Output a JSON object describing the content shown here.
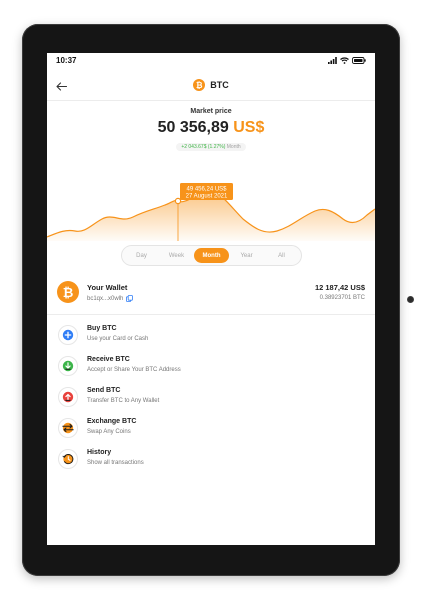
{
  "status": {
    "time": "10:37"
  },
  "header": {
    "coin_symbol": "₿",
    "title": "BTC"
  },
  "market": {
    "label": "Market price",
    "price": "50 356,89",
    "currency": "US$",
    "change": "+2 043.67$ (1.27%)",
    "change_period": "Month"
  },
  "chart": {
    "tooltip_value": "49 456,24 US$",
    "tooltip_date": "27 August 2021",
    "accent": "#f7931a",
    "fill": "#fde3c2"
  },
  "periods": [
    {
      "label": "Day"
    },
    {
      "label": "Week"
    },
    {
      "label": "Month"
    },
    {
      "label": "Year"
    },
    {
      "label": "All"
    }
  ],
  "active_period": "Month",
  "wallet": {
    "title": "Your Wallet",
    "address": "bc1qx...x0wlh",
    "usd": "12 187,42 US$",
    "btc": "0.38923701 BTC"
  },
  "actions": [
    {
      "icon": "plus-icon",
      "title": "Buy BTC",
      "subtitle": "Use your Card or Cash",
      "color": "#2f7df6"
    },
    {
      "icon": "download-icon",
      "title": "Receive BTC",
      "subtitle": "Accept or Share Your BTC Address",
      "color": "#3cb54a"
    },
    {
      "icon": "upload-icon",
      "title": "Send BTC",
      "subtitle": "Transfer BTC to Any Wallet",
      "color": "#e8413c"
    },
    {
      "icon": "exchange-icon",
      "title": "Exchange BTC",
      "subtitle": "Swap Any Coins",
      "color": "#f7931a"
    },
    {
      "icon": "history-icon",
      "title": "History",
      "subtitle": "Show all transactions",
      "color": "#f7931a"
    }
  ]
}
